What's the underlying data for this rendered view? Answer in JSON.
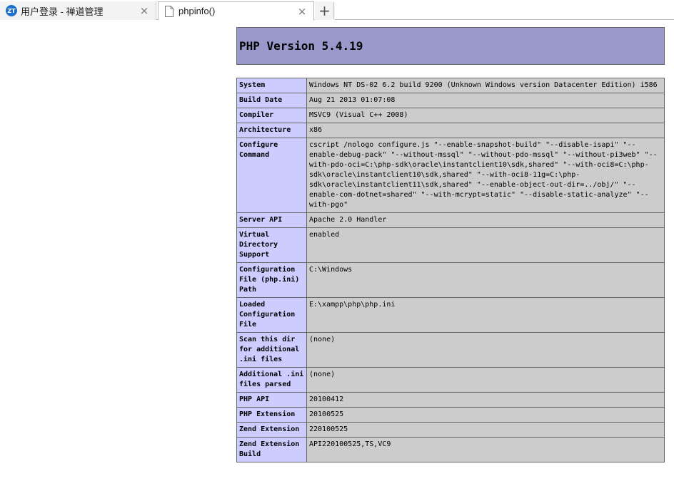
{
  "browser": {
    "tabs": [
      {
        "title": "用户登录 - 禅道管理",
        "icon": "zentao-logo-icon",
        "icon_text": "ZT"
      },
      {
        "title": "phpinfo()",
        "icon": "page-icon"
      }
    ],
    "close_glyph": "×",
    "new_tab_glyph": "+"
  },
  "phpinfo": {
    "header": "PHP Version 5.4.19",
    "rows": [
      {
        "key": "System",
        "value": "Windows NT DS-02 6.2 build 9200 (Unknown Windows version Datacenter Edition) i586"
      },
      {
        "key": "Build Date",
        "value": "Aug 21 2013 01:07:08"
      },
      {
        "key": "Compiler",
        "value": "MSVC9 (Visual C++ 2008)"
      },
      {
        "key": "Architecture",
        "value": "x86"
      },
      {
        "key": "Configure Command",
        "value": "cscript /nologo configure.js \"--enable-snapshot-build\" \"--disable-isapi\" \"--enable-debug-pack\" \"--without-mssql\" \"--without-pdo-mssql\" \"--without-pi3web\" \"--with-pdo-oci=C:\\php-sdk\\oracle\\instantclient10\\sdk,shared\" \"--with-oci8=C:\\php-sdk\\oracle\\instantclient10\\sdk,shared\" \"--with-oci8-11g=C:\\php-sdk\\oracle\\instantclient11\\sdk,shared\" \"--enable-object-out-dir=../obj/\" \"--enable-com-dotnet=shared\" \"--with-mcrypt=static\" \"--disable-static-analyze\" \"--with-pgo\""
      },
      {
        "key": "Server API",
        "value": "Apache 2.0 Handler"
      },
      {
        "key": "Virtual Directory Support",
        "value": "enabled"
      },
      {
        "key": "Configuration File (php.ini) Path",
        "value": "C:\\Windows"
      },
      {
        "key": "Loaded Configuration File",
        "value": "E:\\xampp\\php\\php.ini"
      },
      {
        "key": "Scan this dir for additional .ini files",
        "value": "(none)"
      },
      {
        "key": "Additional .ini files parsed",
        "value": "(none)"
      },
      {
        "key": "PHP API",
        "value": "20100412"
      },
      {
        "key": "PHP Extension",
        "value": "20100525"
      },
      {
        "key": "Zend Extension",
        "value": "220100525"
      },
      {
        "key": "Zend Extension Build",
        "value": "API220100525,TS,VC9"
      }
    ]
  }
}
